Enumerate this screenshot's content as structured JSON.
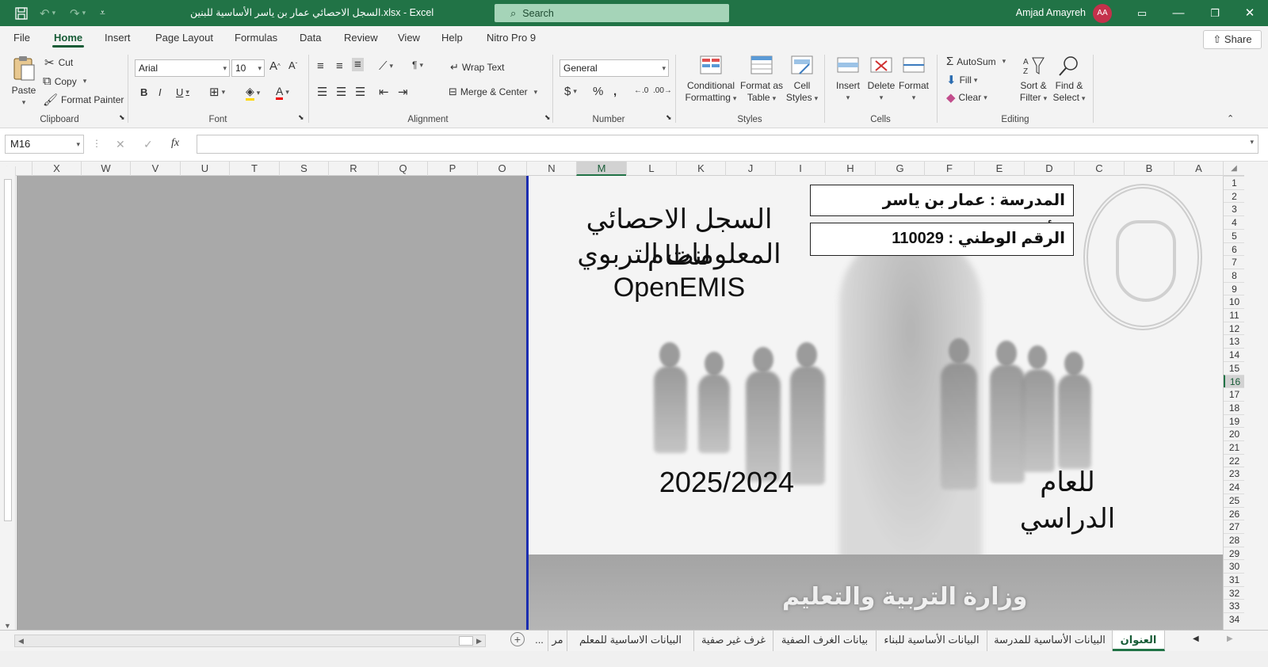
{
  "app": {
    "title": "السجل الاحصائي عمار بن ياسر الأساسية للبنين.xlsx  -  Excel",
    "search_placeholder": "Search",
    "user_name": "Amjad Amayreh",
    "user_initials": "AA"
  },
  "ribbon_tabs": [
    "File",
    "Home",
    "Insert",
    "Page Layout",
    "Formulas",
    "Data",
    "Review",
    "View",
    "Help",
    "Nitro Pro 9"
  ],
  "share_label": "Share",
  "clipboard": {
    "paste": "Paste",
    "cut": "Cut",
    "copy": "Copy",
    "format_painter": "Format Painter",
    "label": "Clipboard"
  },
  "font": {
    "name": "Arial",
    "size": "10",
    "label": "Font"
  },
  "alignment": {
    "wrap_text": "Wrap Text",
    "merge_center": "Merge & Center",
    "label": "Alignment"
  },
  "number": {
    "format": "General",
    "label": "Number"
  },
  "styles": {
    "conditional": "Conditional",
    "formatting": "Formatting",
    "format_as": "Format as",
    "table": "Table",
    "cell": "Cell",
    "cell_styles": "Styles",
    "label": "Styles"
  },
  "cells": {
    "insert": "Insert",
    "delete": "Delete",
    "format": "Format",
    "label": "Cells"
  },
  "editing": {
    "autosum": "AutoSum",
    "fill": "Fill",
    "clear": "Clear",
    "sort": "Sort &",
    "filter": "Filter",
    "find": "Find &",
    "select": "Select",
    "label": "Editing"
  },
  "formula_bar": {
    "name_box": "M16",
    "formula": ""
  },
  "columns": [
    "X",
    "W",
    "V",
    "U",
    "T",
    "S",
    "R",
    "Q",
    "P",
    "O",
    "N",
    "M",
    "L",
    "K",
    "J",
    "I",
    "H",
    "G",
    "F",
    "E",
    "D",
    "C",
    "B",
    "A"
  ],
  "selected_column": "M",
  "rows": [
    "1",
    "2",
    "3",
    "4",
    "5",
    "6",
    "7",
    "8",
    "9",
    "10",
    "11",
    "12",
    "13",
    "14",
    "15",
    "16",
    "17",
    "18",
    "19",
    "20",
    "21",
    "22",
    "23",
    "24",
    "25",
    "26",
    "27",
    "28",
    "29",
    "30",
    "31",
    "32",
    "33",
    "34"
  ],
  "selected_row": "16",
  "sheet": {
    "school": "المدرسة : عمار بن ياسر الأساسية للبنين",
    "national_id": "الرقم الوطني :  110029",
    "heading_line1": "السجل الاحصائي لنظام",
    "heading_line2": "المعلومات التربوي",
    "heading_line3": "OpenEMIS",
    "year_label": "للعام الدراسي",
    "year_value": "2025/2024",
    "ministry": "وزارة التربية والتعليم"
  },
  "sheet_tabs": [
    "العنوان",
    "البيانات الأساسية للمدرسة",
    "البيانات الأساسية للبناء",
    "بيانات الغرف الصفية",
    "غرف غير صفية",
    "البيانات الاساسية للمعلم",
    "مر",
    "..."
  ],
  "colors": {
    "excel_green": "#217346",
    "selection_green": "#185c37",
    "page_edge": "#1a2db0"
  }
}
